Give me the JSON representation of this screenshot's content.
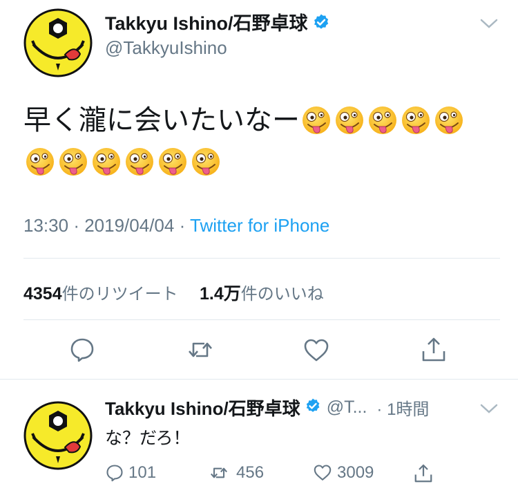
{
  "tweet": {
    "author_name": "Takkyu Ishino/石野卓球",
    "author_handle": "@TakkyuIshino",
    "text": "早く瀧に会いたいなー",
    "emoji_row1_count": 5,
    "emoji_row2_count": 6,
    "time": "13:30",
    "date": "2019/04/04",
    "separator": "·",
    "source": "Twitter for iPhone",
    "retweets_count": "4354",
    "retweets_label": "件のリツイート",
    "likes_count": "1.4万",
    "likes_label": "件のいいね"
  },
  "reply": {
    "author_name": "Takkyu Ishino/石野卓球",
    "author_handle": "@T...",
    "time": "· 1時間",
    "text": "な？だろ！",
    "replies": "101",
    "retweets": "456",
    "likes": "3009"
  },
  "icons": {
    "verified": "verified-badge-icon",
    "reply": "comment-bubble-icon",
    "retweet": "retweet-arrows-icon",
    "like": "heart-icon",
    "share": "share-upload-icon",
    "more": "chevron-down-icon",
    "emoji": "zany-face-emoji"
  },
  "colors": {
    "accent": "#1da1f2",
    "secondary_text": "#657786",
    "divider": "#e1e8ed"
  }
}
